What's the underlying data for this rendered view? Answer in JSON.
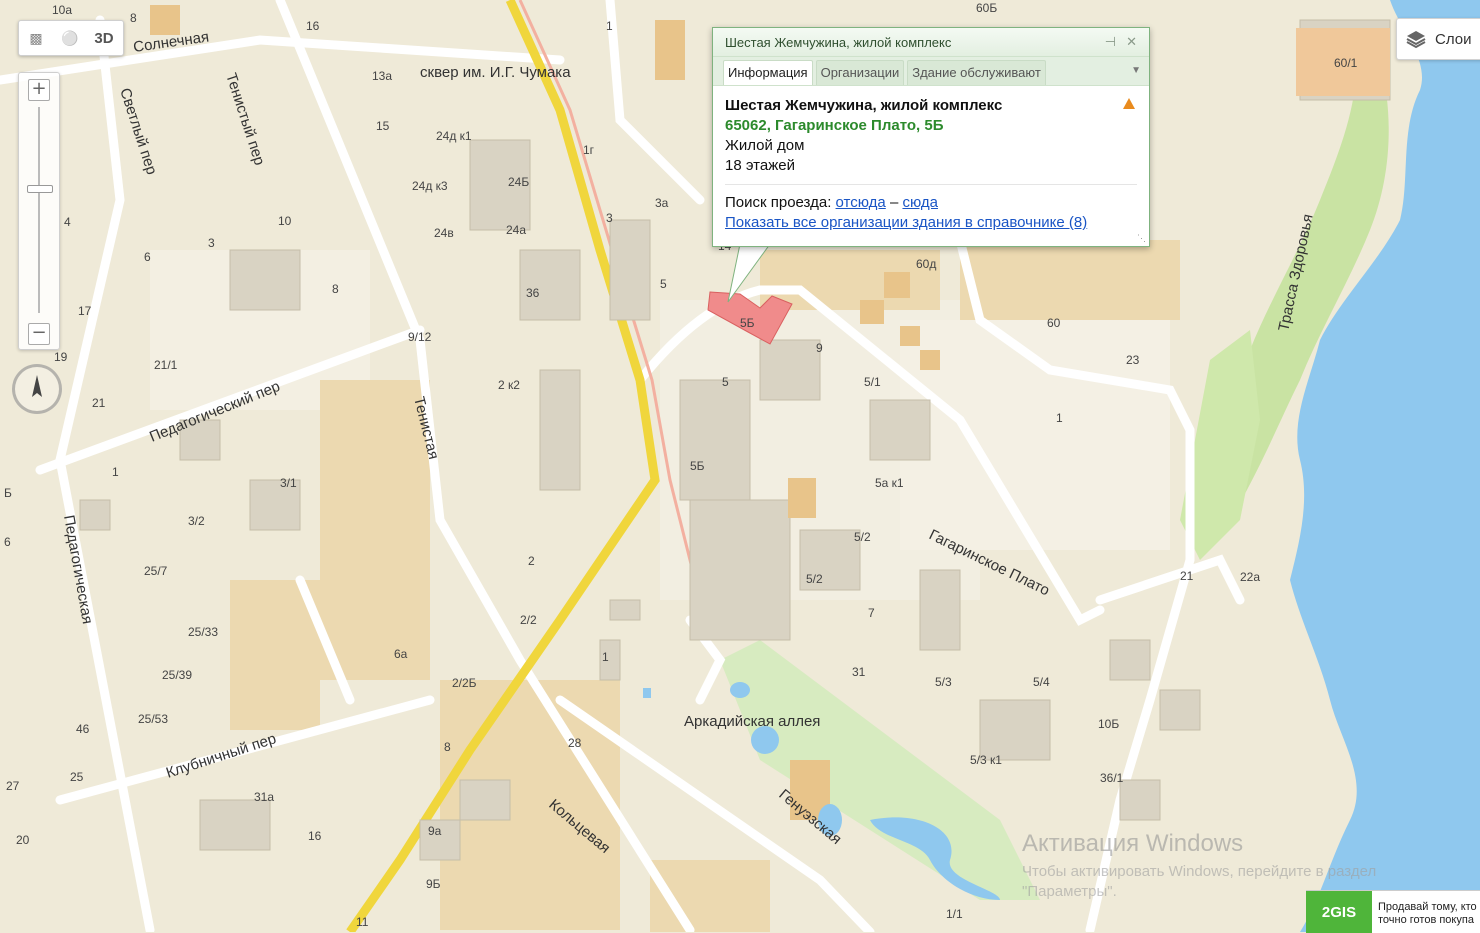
{
  "controls": {
    "view_3d": "3D",
    "ruler_icon": "ruler-icon",
    "measure_icon": "measure-icon",
    "zoom_in": "+",
    "zoom_out": "−",
    "compass_icon": "compass-icon",
    "layers_label": "Слои",
    "layers_icon": "layers-icon"
  },
  "popup": {
    "header_title": "Шестая Жемчужина, жилой комплекс",
    "tabs": [
      "Информация",
      "Организации",
      "Здание обслуживают"
    ],
    "name": "Шестая Жемчужина, жилой комплекс",
    "address": "65062, Гагаринское Плато, 5Б",
    "type": "Жилой дом",
    "floors": "18 этажей",
    "route_prefix": "Поиск проезда:",
    "route_from": "отсюда",
    "route_dash": "–",
    "route_to": "сюда",
    "all_orgs": "Показать все организации здания в справочнике (8)",
    "pin_icon": "pin-icon",
    "close_icon": "close-icon",
    "warning_icon": "warning-icon"
  },
  "map": {
    "streets": {
      "solnechnaya": "Солнечная",
      "square": "сквер им. И.Г. Чумака",
      "svetly": "Светлый пер",
      "tenisty": "Тенистый пер",
      "pedagog_per": "Педагогический пер",
      "tenistaya": "Тенистая",
      "pedagog": "Педагогическая",
      "klubnichny": "Клубничный пер",
      "koltsevaya": "Кольцевая",
      "arkadia": "Аркадийская аллея",
      "genuezskaya": "Генуэзская",
      "gagarin": "Гагаринское Плато",
      "trassa": "Трасса Здоровья"
    },
    "labels": [
      "10а",
      "8",
      "16",
      "13а",
      "15",
      "24д к1",
      "24д к3",
      "24Б",
      "24в",
      "24а",
      "1г",
      "3а",
      "3",
      "1",
      "5",
      "14",
      "60д",
      "60Б",
      "60/1",
      "60",
      "23",
      "5Б",
      "9",
      "5/1",
      "5",
      "5Б",
      "5а к1",
      "5/2",
      "5/2",
      "7",
      "31",
      "5/3",
      "5/4",
      "5/3 к1",
      "10Б",
      "36/1",
      "21",
      "22а",
      "1",
      "4",
      "6",
      "3",
      "10",
      "8",
      "17",
      "19",
      "21/1",
      "21",
      "1",
      "3/1",
      "3/2",
      "25/7",
      "25/33",
      "25/39",
      "25/53",
      "46",
      "25",
      "27",
      "20",
      "31а",
      "16",
      "11",
      "9а",
      "9Б",
      "8",
      "28",
      "2/2Б",
      "2/2",
      "2",
      "6а",
      "2 к2",
      "36",
      "9/12",
      "1",
      "1/1",
      "Б",
      "6"
    ]
  },
  "watermark": {
    "title": "Активация Windows",
    "line1": "Чтобы активировать Windows, перейдите в раздел",
    "line2": "\"Параметры\"."
  },
  "ad": {
    "logo": "2GIS",
    "line1": "Продавай тому, кто",
    "line2": "точно готов покупа"
  }
}
